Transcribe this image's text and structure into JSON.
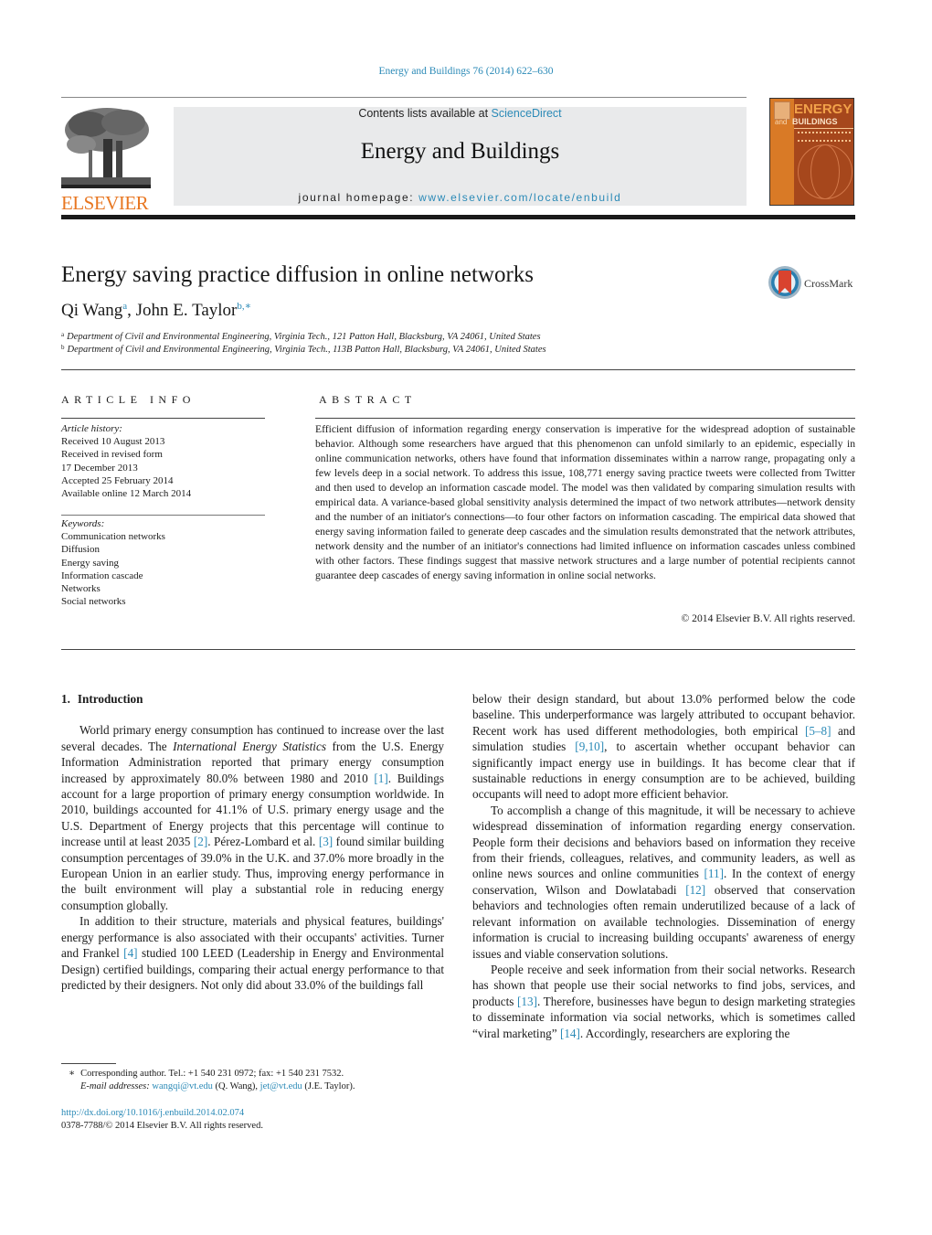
{
  "journal_ref": "Energy and Buildings 76 (2014) 622–630",
  "header": {
    "publisher_logo_text": "ELSEVIER",
    "contents_prefix": "Contents lists available at ",
    "contents_link": "ScienceDirect",
    "journal_title": "Energy and Buildings",
    "homepage_prefix": "journal homepage: ",
    "homepage_link": "www.elsevier.com/locate/enbuild",
    "cover": {
      "title_top": "ENERGY",
      "title_and": "and",
      "title_bottom": "BUILDINGS"
    }
  },
  "colors": {
    "link": "#2b8ab7",
    "elsevier_orange": "#e87722",
    "cover_brown": "#a6471c"
  },
  "article": {
    "title": "Energy saving practice diffusion in online networks",
    "crossmark_label": "CrossMark",
    "authors": [
      {
        "name": "Qi Wang",
        "sup": "a"
      },
      {
        "name": "John E. Taylor",
        "sup": "b,∗"
      }
    ],
    "author_separator": ", ",
    "affiliations": [
      {
        "sup": "a",
        "text": "Department of Civil and Environmental Engineering, Virginia Tech., 121 Patton Hall, Blacksburg, VA 24061, United States"
      },
      {
        "sup": "b",
        "text": "Department of Civil and Environmental Engineering, Virginia Tech., 113B Patton Hall, Blacksburg, VA 24061, United States"
      }
    ]
  },
  "article_info": {
    "heading": "ARTICLE INFO",
    "history_label": "Article history:",
    "history": [
      "Received 10 August 2013",
      "Received in revised form",
      "17 December 2013",
      "Accepted 25 February 2014",
      "Available online 12 March 2014"
    ],
    "keywords_label": "Keywords:",
    "keywords": [
      "Communication networks",
      "Diffusion",
      "Energy saving",
      "Information cascade",
      "Networks",
      "Social networks"
    ]
  },
  "abstract": {
    "heading": "ABSTRACT",
    "text": "Efficient diffusion of information regarding energy conservation is imperative for the widespread adoption of sustainable behavior. Although some researchers have argued that this phenomenon can unfold similarly to an epidemic, especially in online communication networks, others have found that information disseminates within a narrow range, propagating only a few levels deep in a social network. To address this issue, 108,771 energy saving practice tweets were collected from Twitter and then used to develop an information cascade model. The model was then validated by comparing simulation results with empirical data. A variance-based global sensitivity analysis determined the impact of two network attributes—network density and the number of an initiator's connections—to four other factors on information cascading. The empirical data showed that energy saving information failed to generate deep cascades and the simulation results demonstrated that the network attributes, network density and the number of an initiator's connections had limited influence on information cascades unless combined with other factors. These findings suggest that massive network structures and a large number of potential recipients cannot guarantee deep cascades of energy saving information in online social networks.",
    "copyright": "© 2014 Elsevier B.V. All rights reserved."
  },
  "body": {
    "section_number": "1.",
    "section_title": "Introduction",
    "left_paragraphs": [
      [
        {
          "t": "World primary energy consumption has continued to increase over the last several decades. The "
        },
        {
          "t": "International Energy Statistics",
          "style": "italic"
        },
        {
          "t": " from the U.S. Energy Information Administration reported that primary energy consumption increased by approximately 80.0% between 1980 and 2010 "
        },
        {
          "t": "[1]",
          "style": "link"
        },
        {
          "t": ". Buildings account for a large proportion of primary energy consumption worldwide. In 2010, buildings accounted for 41.1% of U.S. primary energy usage and the U.S. Department of Energy projects that this percentage will continue to increase until at least 2035 "
        },
        {
          "t": "[2]",
          "style": "link"
        },
        {
          "t": ". Pérez-Lombard et al. "
        },
        {
          "t": "[3]",
          "style": "link"
        },
        {
          "t": " found similar building consumption percentages of 39.0% in the U.K. and 37.0% more broadly in the European Union in an earlier study. Thus, improving energy performance in the built environment will play a substantial role in reducing energy consumption globally."
        }
      ],
      [
        {
          "t": "In addition to their structure, materials and physical features, buildings' energy performance is also associated with their occupants' activities. Turner and Frankel "
        },
        {
          "t": "[4]",
          "style": "link"
        },
        {
          "t": " studied 100 LEED (Leadership in Energy and Environmental Design) certified buildings, comparing their actual energy performance to that predicted by their designers. Not only did about 33.0% of the buildings fall"
        }
      ]
    ],
    "right_paragraphs": [
      [
        {
          "t": "below their design standard, but about 13.0% performed below the code baseline. This underperformance was largely attributed to occupant behavior. Recent work has used different methodologies, both empirical "
        },
        {
          "t": "[5–8]",
          "style": "link"
        },
        {
          "t": " and simulation studies "
        },
        {
          "t": "[9,10]",
          "style": "link"
        },
        {
          "t": ", to ascertain whether occupant behavior can significantly impact energy use in buildings. It has become clear that if sustainable reductions in energy consumption are to be achieved, building occupants will need to adopt more efficient behavior."
        }
      ],
      [
        {
          "t": "To accomplish a change of this magnitude, it will be necessary to achieve widespread dissemination of information regarding energy conservation. People form their decisions and behaviors based on information they receive from their friends, colleagues, relatives, and community leaders, as well as online news sources and online communities "
        },
        {
          "t": "[11]",
          "style": "link"
        },
        {
          "t": ". In the context of energy conservation, Wilson and Dowlatabadi "
        },
        {
          "t": "[12]",
          "style": "link"
        },
        {
          "t": " observed that conservation behaviors and technologies often remain underutilized because of a lack of relevant information on available technologies. Dissemination of energy information is crucial to increasing building occupants' awareness of energy issues and viable conservation solutions."
        }
      ],
      [
        {
          "t": "People receive and seek information from their social networks. Research has shown that people use their social networks to find jobs, services, and products "
        },
        {
          "t": "[13]",
          "style": "link"
        },
        {
          "t": ". Therefore, businesses have begun to design marketing strategies to disseminate information via social networks, which is sometimes called “viral marketing” "
        },
        {
          "t": "[14]",
          "style": "link"
        },
        {
          "t": ". Accordingly, researchers are exploring the"
        }
      ]
    ]
  },
  "footnotes": {
    "corresponding_mark": "∗",
    "corresponding_text": "Corresponding author. Tel.: +1 540 231 0972; fax: +1 540 231 7532.",
    "email_label": "E-mail addresses:",
    "emails": [
      {
        "address": "wangqi@vt.edu",
        "owner": " (Q. Wang), "
      },
      {
        "address": "jet@vt.edu",
        "owner": " (J.E. Taylor)."
      }
    ],
    "doi": "http://dx.doi.org/10.1016/j.enbuild.2014.02.074",
    "issn_copyright": "0378-7788/© 2014 Elsevier B.V. All rights reserved."
  }
}
